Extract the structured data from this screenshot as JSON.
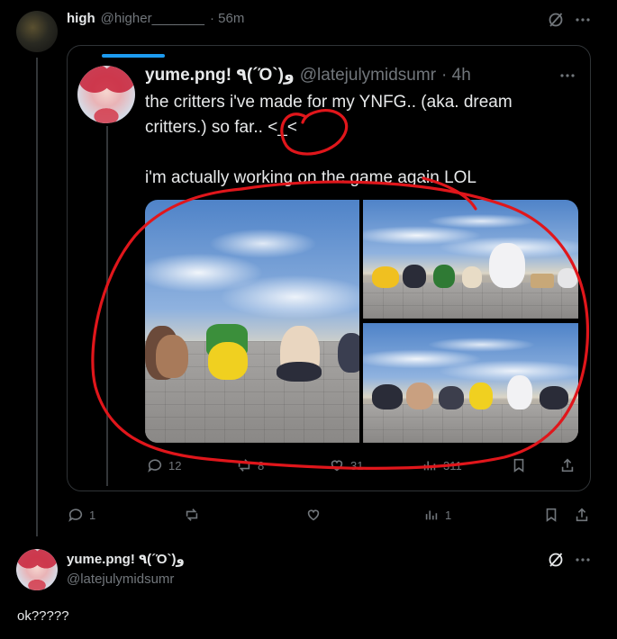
{
  "post": {
    "name": "high",
    "handle": "@higher_______",
    "time": "· 56m",
    "quote": {
      "name": "yume.png! ٩(´Ό`)و",
      "handle": "@latejulymidsumr",
      "time": "· 4h",
      "line1": "the critters i've made for my YNFG.. (aka. dream",
      "line2": "critters.) so far.. <_<",
      "line3": "i'm actually working on the game again LOL",
      "actions": {
        "replies": "12",
        "reposts": "8",
        "likes": "31",
        "views": "311"
      }
    },
    "actions": {
      "replies": "1",
      "reposts": "",
      "likes": "",
      "views": "1"
    }
  },
  "reply": {
    "name": "yume.png! ٩(´Ό`)و",
    "handle": "@latejulymidsumr",
    "text": "ok?????"
  },
  "colors": {
    "background": "#000000",
    "text": "#e7e9ea",
    "muted": "#71767b",
    "annotation": "#e0161b",
    "accent": "#1d9bf0"
  }
}
